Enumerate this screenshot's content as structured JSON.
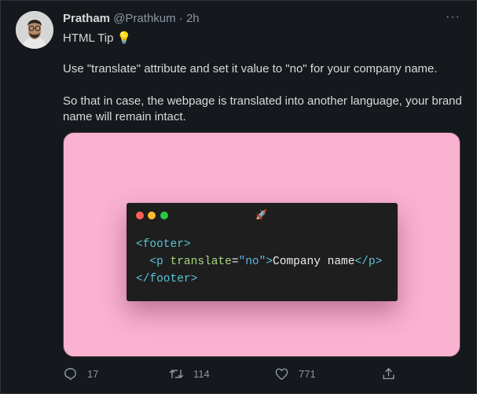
{
  "tweet": {
    "author_name": "Pratham",
    "handle": "@Prathkum",
    "separator": "·",
    "time": "2h",
    "line1": "HTML Tip 💡",
    "line2": "Use \"translate\" attribute and set it value to \"no\" for your company name.",
    "line3": "So that in case, the webpage is translated into another language, your brand name will remain intact.",
    "more_icon": "···"
  },
  "media": {
    "rocket": "🚀",
    "code": {
      "l1_open": "<footer>",
      "l2_indent": "  ",
      "l2_p_open": "<p",
      "l2_attr": " translate",
      "l2_eq": "=",
      "l2_val": "\"no\"",
      "l2_close_bracket": ">",
      "l2_text": "Company name",
      "l2_p_close": "</p>",
      "l3_close": "</footer>"
    }
  },
  "actions": {
    "reply_count": "17",
    "retweet_count": "114",
    "like_count": "771"
  },
  "colors": {
    "background": "#15181c",
    "media_background": "#f9b2d0",
    "code_background": "#1e1e1e",
    "muted": "#8b98a5"
  }
}
